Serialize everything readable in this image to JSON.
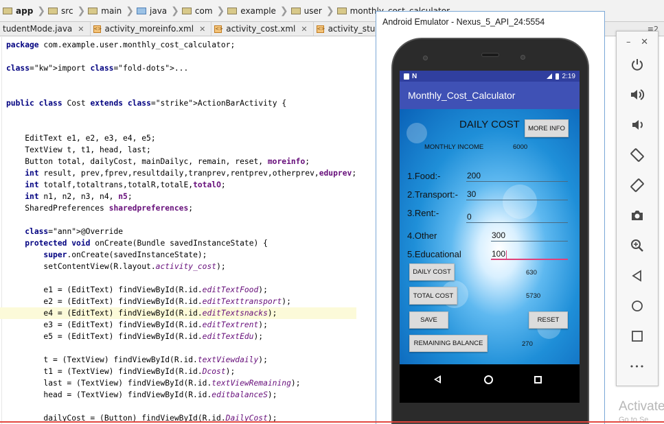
{
  "breadcrumb": [
    "app",
    "src",
    "main",
    "java",
    "com",
    "example",
    "user",
    "monthly_cost_calculator"
  ],
  "tabs": [
    {
      "label": "tudentMode.java"
    },
    {
      "label": "activity_moreinfo.xml"
    },
    {
      "label": "activity_cost.xml"
    },
    {
      "label": "activity_student_mo"
    }
  ],
  "tab_overflow": "≡2",
  "editor": {
    "lines": [
      "package com.example.user.monthly_cost_calculator;",
      "",
      "import ...",
      "",
      "",
      "public class Cost extends ActionBarActivity {",
      "",
      "",
      "    EditText e1, e2, e3, e4, e5;",
      "    TextView t, t1, head, last;",
      "    Button total, dailyCost, mainDailyc, remain, reset, moreinfo;",
      "    int result, prev,fprev,resultdaily,tranprev,rentprev,otherprev,eduprev;",
      "    int totalf,totaltrans,totalR,totalE,totalO;",
      "    int n1, n2, n3, n4, n5;",
      "    SharedPreferences sharedpreferences;",
      "",
      "    @Override",
      "    protected void onCreate(Bundle savedInstanceState) {",
      "        super.onCreate(savedInstanceState);",
      "        setContentView(R.layout.activity_cost);",
      "",
      "        e1 = (EditText) findViewById(R.id.editTextFood);",
      "        e2 = (EditText) findViewById(R.id.editTexttransport);",
      "        e4 = (EditText) findViewById(R.id.editTextsnacks);",
      "        e3 = (EditText) findViewById(R.id.editTextrent);",
      "        e5 = (EditText) findViewById(R.id.editTextEdu);",
      "",
      "        t = (TextView) findViewById(R.id.textViewdaily);",
      "        t1 = (TextView) findViewById(R.id.Dcost);",
      "        last = (TextView) findViewById(R.id.textViewRemaining);",
      "        head = (TextView) findViewById(R.id.editbalanceS);",
      "",
      "        dailyCost = (Button) findViewById(R.id.DailyCost);"
    ]
  },
  "emulator": {
    "window_title": "Android Emulator - Nexus_5_API_24:5554",
    "status_time": "2:19",
    "app_title": "Monthly_Cost_Calculator",
    "heading": "DAILY COST",
    "more_info_button": "MORE INFO",
    "monthly_income_label": "MONTHLY INCOME",
    "monthly_income_value": "6000",
    "food_label": "1.Food:-",
    "food_value": "200",
    "transport_label": "2.Transport:-",
    "transport_value": "30",
    "rent_label": "3.Rent:-",
    "rent_value": "0",
    "other_label": "4.Other",
    "other_value": "300",
    "educational_label": "5.Educational",
    "educational_value": "100",
    "daily_cost_button": "DAILY COST",
    "daily_cost_value": "630",
    "total_cost_button": "TOTAL COST",
    "total_cost_value": "5730",
    "save_button": "SAVE",
    "reset_button": "RESET",
    "remaining_button": "REMAINING BALANCE",
    "remaining_value": "270"
  },
  "side_toolbar": {
    "minimize": "–",
    "close": "✕",
    "more": "•••",
    "tools": [
      "power-icon",
      "volume-up-icon",
      "volume-down-icon",
      "rotate-left-icon",
      "rotate-right-icon",
      "camera-icon",
      "zoom-icon",
      "back-icon",
      "home-icon",
      "overview-icon"
    ]
  },
  "watermark": {
    "line1": "Activate",
    "line2": "Go to Se"
  },
  "colors": {
    "status_bar": "#303f9f",
    "action_bar": "#3f51b5",
    "keyword": "#000080",
    "field": "#660e7a",
    "annotation": "#808000",
    "accent_pink": "#e0407a"
  }
}
